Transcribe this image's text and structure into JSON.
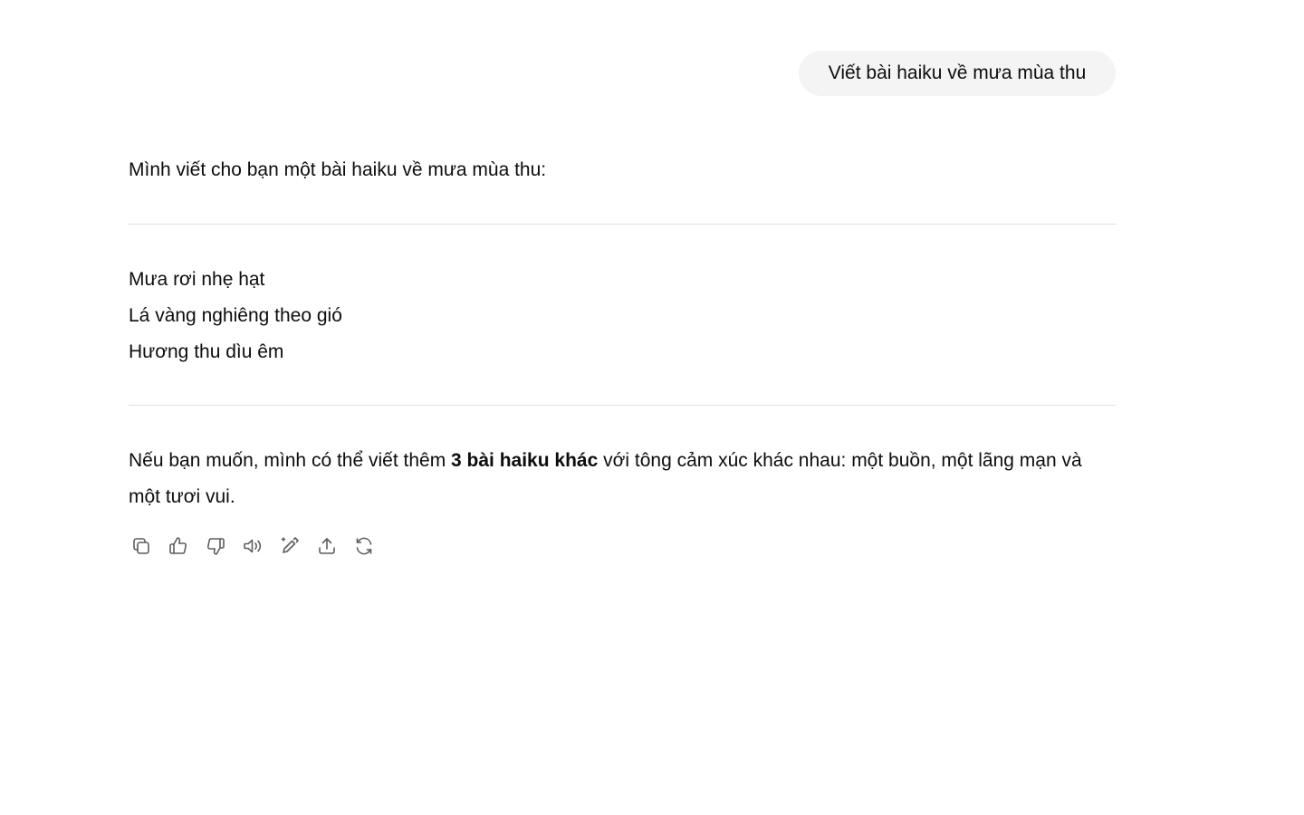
{
  "user_message": {
    "text": "Viết bài haiku về mưa mùa thu"
  },
  "assistant_message": {
    "intro": "Mình viết cho bạn một bài haiku về mưa mùa thu:",
    "poem_lines": [
      "Mưa rơi nhẹ hạt",
      "Lá vàng nghiêng theo gió",
      "Hương thu dìu êm"
    ],
    "followup": {
      "before_bold": "Nếu bạn muốn, mình có thể viết thêm ",
      "bold": "3 bài haiku khác",
      "after_bold": " với tông cảm xúc khác nhau: một buồn, một lãng mạn và một tươi vui."
    }
  },
  "actions": [
    {
      "icon": "copy-icon"
    },
    {
      "icon": "thumbs-up-icon"
    },
    {
      "icon": "thumbs-down-icon"
    },
    {
      "icon": "read-aloud-icon"
    },
    {
      "icon": "edit-canvas-icon"
    },
    {
      "icon": "share-icon"
    },
    {
      "icon": "regenerate-icon"
    }
  ],
  "colors": {
    "bubble_bg": "#f4f4f4",
    "text": "#0d0d0d",
    "icon": "#5d5d5d",
    "divider": "#e0e0e0"
  }
}
